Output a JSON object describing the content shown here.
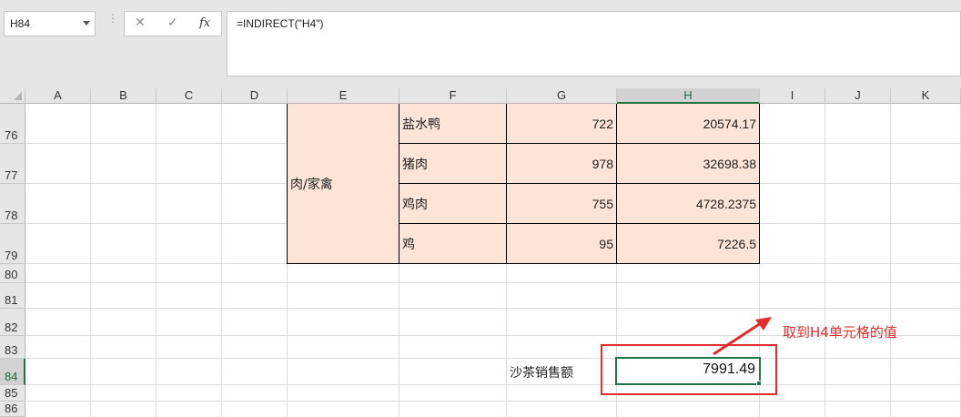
{
  "name_box": {
    "value": "H84"
  },
  "formula_bar": {
    "cancel_icon": "✕",
    "enter_icon": "✓",
    "fx_label": "fx",
    "formula": "=INDIRECT(\"H4\")"
  },
  "columns": [
    "A",
    "B",
    "C",
    "D",
    "E",
    "F",
    "G",
    "H",
    "I",
    "J",
    "K"
  ],
  "active_column": "H",
  "rows": [
    "76",
    "77",
    "78",
    "79",
    "80",
    "81",
    "82",
    "83",
    "84",
    "85",
    "86"
  ],
  "active_row": "84",
  "table": {
    "category": "肉/家禽",
    "rows": [
      {
        "item": "盐水鸭",
        "qty": "722",
        "amount": "20574.17"
      },
      {
        "item": "猪肉",
        "qty": "978",
        "amount": "32698.38"
      },
      {
        "item": "鸡肉",
        "qty": "755",
        "amount": "4728.2375"
      },
      {
        "item": "鸡",
        "qty": "95",
        "amount": "7226.5"
      }
    ],
    "fill_color": "#fce4d6"
  },
  "label_cell": "沙茶销售额",
  "selected_cell_value": "7991.49",
  "annotation": "取到H4单元格的值",
  "colors": {
    "accent": "#217346",
    "annotation": "#e02d2d"
  }
}
